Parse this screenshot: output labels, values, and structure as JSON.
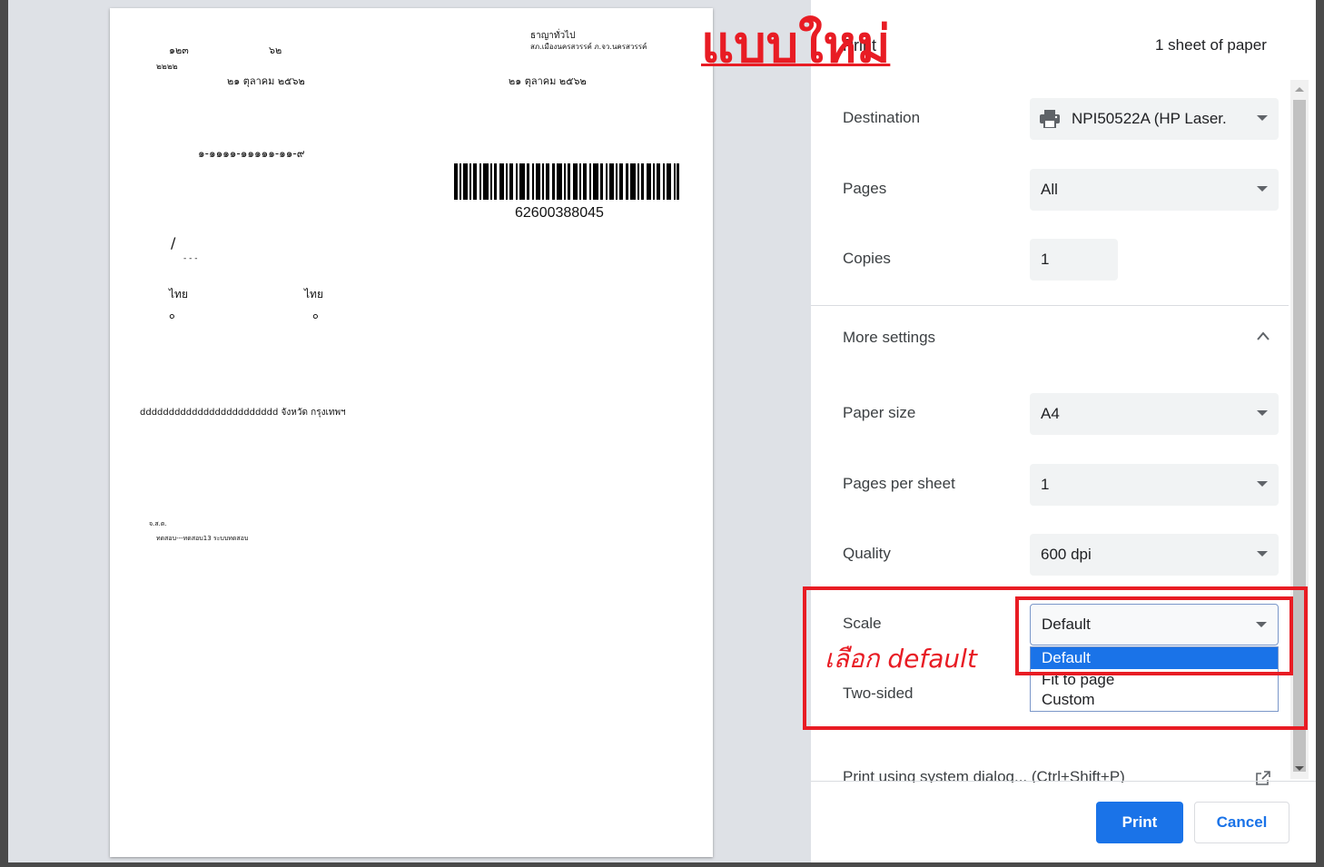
{
  "annotations": {
    "new_style_title": "แบบใหม่",
    "choose_default_note": "เลือก default",
    "highlight_color": "#e81c24"
  },
  "preview": {
    "page_number_left": "๑๒๓",
    "page_number_mid": "๖๒",
    "code_small": "๒๒๒๒",
    "date_left": "๒๑ ตุลาคม ๒๕๖๒",
    "header_right_line1": "ธาญาทั่วไป",
    "header_right_line2": "สภ.เมืองนครสวรรค์ ภ.จว.นครสวรรค์",
    "date_right": "๒๑ ตุลาคม ๒๕๖๒",
    "id_number": "๑-๑๑๑๑-๑๑๑๑๑-๑๑-๙",
    "barcode_number": "62600388045",
    "slash": "/",
    "dashes": "- - -",
    "nationality_left": "ไทย",
    "nationality_right": "ไทย",
    "zero_left": "๐",
    "zero_right": "๐",
    "address_line": "dddddddddddddddddddddddd จังหวัด กรุงเทพฯ",
    "small_label": "จ.ส.ต.",
    "small_line": "ทดสอบ---ทดสอบ13 ระบบทดสอบ"
  },
  "print_panel": {
    "title": "Print",
    "sheets": "1 sheet of paper",
    "destination": {
      "label": "Destination",
      "value": "NPI50522A (HP Laser."
    },
    "pages": {
      "label": "Pages",
      "value": "All"
    },
    "copies": {
      "label": "Copies",
      "value": "1"
    },
    "more_settings": {
      "label": "More settings"
    },
    "paper_size": {
      "label": "Paper size",
      "value": "A4"
    },
    "pages_per_sheet": {
      "label": "Pages per sheet",
      "value": "1"
    },
    "quality": {
      "label": "Quality",
      "value": "600 dpi"
    },
    "scale": {
      "label": "Scale",
      "value": "Default",
      "options": [
        "Default",
        "Fit to page",
        "Custom"
      ]
    },
    "two_sided": {
      "label": "Two-sided"
    },
    "system_dialog": "Print using system dialog... (Ctrl+Shift+P)",
    "print_button": "Print",
    "cancel_button": "Cancel",
    "accent_color": "#1a73e8"
  }
}
